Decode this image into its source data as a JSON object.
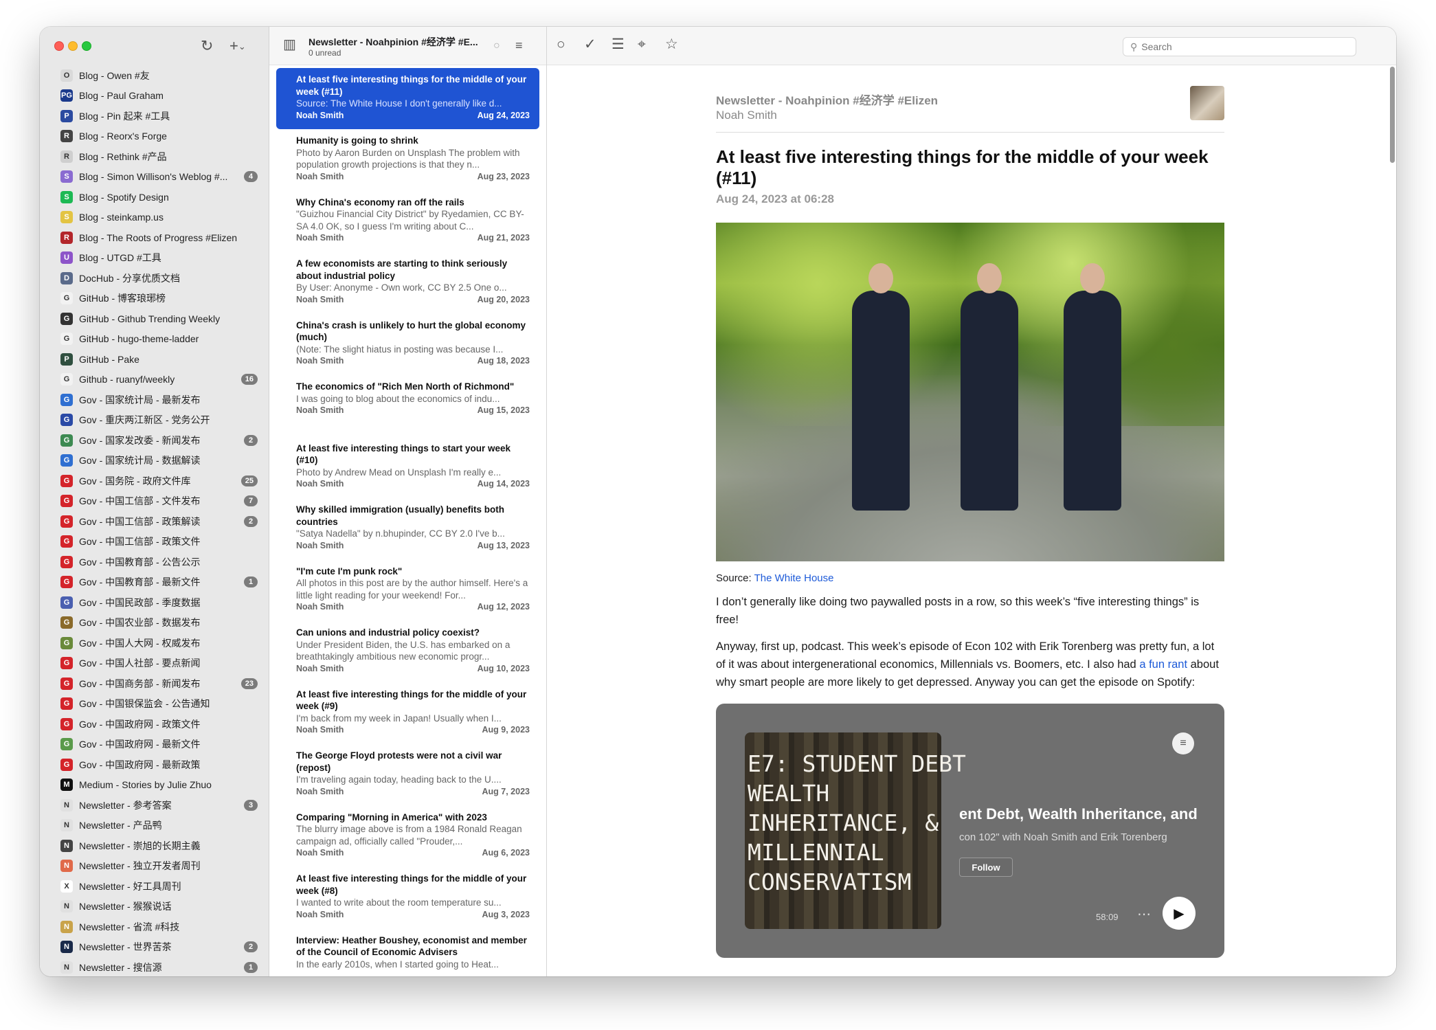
{
  "sidebar": {
    "feeds": [
      {
        "label": "Blog - Owen #友",
        "badge": "",
        "color": "#d9d9d9",
        "glyph": "O"
      },
      {
        "label": "Blog - Paul Graham",
        "badge": "",
        "color": "#1b3a8c",
        "glyph": "PG"
      },
      {
        "label": "Blog - Pin 起来 #工具",
        "badge": "",
        "color": "#2b4aa0",
        "glyph": "P"
      },
      {
        "label": "Blog - Reorx's Forge",
        "badge": "",
        "color": "#444444",
        "glyph": "R"
      },
      {
        "label": "Blog - Rethink #产品",
        "badge": "",
        "color": "#cfcfcf",
        "glyph": "R"
      },
      {
        "label": "Blog - Simon Willison's Weblog #...",
        "badge": "4",
        "color": "#8a6bd1",
        "glyph": "S"
      },
      {
        "label": "Blog - Spotify Design",
        "badge": "",
        "color": "#1db954",
        "glyph": "S"
      },
      {
        "label": "Blog - steinkamp.us",
        "badge": "",
        "color": "#e3c443",
        "glyph": "S"
      },
      {
        "label": "Blog - The Roots of Progress #Elizen",
        "badge": "",
        "color": "#b3262b",
        "glyph": "R"
      },
      {
        "label": "Blog - UTGD #工具",
        "badge": "",
        "color": "#8d54c9",
        "glyph": "U"
      },
      {
        "label": "DocHub - 分享优质文档",
        "badge": "",
        "color": "#5a6a8a",
        "glyph": "D"
      },
      {
        "label": "GitHub - 博客琅琊榜",
        "badge": "",
        "color": "#f2f2f2",
        "glyph": "G"
      },
      {
        "label": "GitHub - Github Trending Weekly",
        "badge": "",
        "color": "#333333",
        "glyph": "G"
      },
      {
        "label": "GitHub - hugo-theme-ladder",
        "badge": "",
        "color": "#f2f2f2",
        "glyph": "G"
      },
      {
        "label": "GitHub - Pake",
        "badge": "",
        "color": "#2f4f3f",
        "glyph": "P"
      },
      {
        "label": "Github - ruanyf/weekly",
        "badge": "16",
        "color": "#f2f2f2",
        "glyph": "G"
      },
      {
        "label": "Gov - 国家统计局 - 最新发布",
        "badge": "",
        "color": "#2f6fd1",
        "glyph": "G"
      },
      {
        "label": "Gov - 重庆两江新区 - 党务公开",
        "badge": "",
        "color": "#2a4aa6",
        "glyph": "G"
      },
      {
        "label": "Gov - 国家发改委 - 新闻发布",
        "badge": "2",
        "color": "#3d8a52",
        "glyph": "G"
      },
      {
        "label": "Gov - 国家统计局 - 数据解读",
        "badge": "",
        "color": "#2f6fd1",
        "glyph": "G"
      },
      {
        "label": "Gov - 国务院 - 政府文件库",
        "badge": "25",
        "color": "#d4242a",
        "glyph": "G"
      },
      {
        "label": "Gov - 中国工信部 - 文件发布",
        "badge": "7",
        "color": "#d4242a",
        "glyph": "G"
      },
      {
        "label": "Gov - 中国工信部 - 政策解读",
        "badge": "2",
        "color": "#d4242a",
        "glyph": "G"
      },
      {
        "label": "Gov - 中国工信部 - 政策文件",
        "badge": "",
        "color": "#d4242a",
        "glyph": "G"
      },
      {
        "label": "Gov - 中国教育部 - 公告公示",
        "badge": "",
        "color": "#d4242a",
        "glyph": "G"
      },
      {
        "label": "Gov - 中国教育部 - 最新文件",
        "badge": "1",
        "color": "#d4242a",
        "glyph": "G"
      },
      {
        "label": "Gov - 中国民政部 - 季度数据",
        "badge": "",
        "color": "#4a5fb0",
        "glyph": "G"
      },
      {
        "label": "Gov - 中国农业部 - 数据发布",
        "badge": "",
        "color": "#8a6a2a",
        "glyph": "G"
      },
      {
        "label": "Gov - 中国人大网 - 权威发布",
        "badge": "",
        "color": "#6a8a3a",
        "glyph": "G"
      },
      {
        "label": "Gov - 中国人社部 - 要点新闻",
        "badge": "",
        "color": "#d4242a",
        "glyph": "G"
      },
      {
        "label": "Gov - 中国商务部 - 新闻发布",
        "badge": "23",
        "color": "#d4242a",
        "glyph": "G"
      },
      {
        "label": "Gov - 中国银保监会 - 公告通知",
        "badge": "",
        "color": "#d4242a",
        "glyph": "G"
      },
      {
        "label": "Gov - 中国政府网 - 政策文件",
        "badge": "",
        "color": "#d4242a",
        "glyph": "G"
      },
      {
        "label": "Gov - 中国政府网 - 最新文件",
        "badge": "",
        "color": "#5a9a4a",
        "glyph": "G"
      },
      {
        "label": "Gov - 中国政府网 - 最新政策",
        "badge": "",
        "color": "#d4242a",
        "glyph": "G"
      },
      {
        "label": "Medium - Stories by Julie Zhuo",
        "badge": "",
        "color": "#111111",
        "glyph": "M"
      },
      {
        "label": "Newsletter - 参考答案",
        "badge": "3",
        "color": "#e0e0e0",
        "glyph": "N"
      },
      {
        "label": "Newsletter - 产品鸭",
        "badge": "",
        "color": "#e0e0e0",
        "glyph": "N"
      },
      {
        "label": "Newsletter - 崇旭的长期主義",
        "badge": "",
        "color": "#444444",
        "glyph": "N"
      },
      {
        "label": "Newsletter - 独立开发者周刊",
        "badge": "",
        "color": "#e06a4a",
        "glyph": "N"
      },
      {
        "label": "Newsletter - 好工具周刊",
        "badge": "",
        "color": "#ffffff",
        "glyph": "X"
      },
      {
        "label": "Newsletter - 猴猴说话",
        "badge": "",
        "color": "#e0e0e0",
        "glyph": "N"
      },
      {
        "label": "Newsletter - 省流 #科技",
        "badge": "",
        "color": "#c9a34a",
        "glyph": "N"
      },
      {
        "label": "Newsletter - 世界苦茶",
        "badge": "2",
        "color": "#1a2a4a",
        "glyph": "N"
      },
      {
        "label": "Newsletter - 搜信源",
        "badge": "1",
        "color": "#e0e0e0",
        "glyph": "N"
      }
    ]
  },
  "list": {
    "title": "Newsletter - Noahpinion #经济学 #E...",
    "unread": "0 unread",
    "articles": [
      {
        "title": "At least five interesting things for the middle of your week (#11)",
        "snippet": "Source: The White House I don't generally like d...",
        "author": "Noah Smith",
        "date": "Aug 24, 2023"
      },
      {
        "title": "Humanity is going to shrink",
        "snippet": "Photo by Aaron Burden on Unsplash The problem with population growth projections is that they n...",
        "author": "Noah Smith",
        "date": "Aug 23, 2023"
      },
      {
        "title": "Why China's economy ran off the rails",
        "snippet": "\"Guizhou Financial City District\" by Ryedamien, CC BY-SA 4.0 OK, so I guess I'm writing about C...",
        "author": "Noah Smith",
        "date": "Aug 21, 2023"
      },
      {
        "title": "A few economists are starting to think seriously about industrial policy",
        "snippet": "By User: Anonyme - Own work, CC BY 2.5 One o...",
        "author": "Noah Smith",
        "date": "Aug 20, 2023"
      },
      {
        "title": "China's crash is unlikely to hurt the global economy (much)",
        "snippet": "(Note: The slight hiatus in posting was because I...",
        "author": "Noah Smith",
        "date": "Aug 18, 2023"
      },
      {
        "title": "The economics of \"Rich Men North of Richmond\"",
        "snippet": "I was going to blog about the economics of indu...",
        "author": "Noah Smith",
        "date": "Aug 15, 2023"
      },
      {
        "title": "At least five interesting things to start your week (#10)",
        "snippet": "Photo by Andrew Mead on Unsplash I'm really e...",
        "author": "Noah Smith",
        "date": "Aug 14, 2023"
      },
      {
        "title": "Why skilled immigration (usually) benefits both countries",
        "snippet": "\"Satya Nadella\" by n.bhupinder, CC BY 2.0 I've b...",
        "author": "Noah Smith",
        "date": "Aug 13, 2023"
      },
      {
        "title": "\"I'm cute I'm punk rock\"",
        "snippet": "All photos in this post are by the author himself. Here's a little light reading for your weekend! For...",
        "author": "Noah Smith",
        "date": "Aug 12, 2023"
      },
      {
        "title": "Can unions and industrial policy coexist?",
        "snippet": "Under President Biden, the U.S. has embarked on a breathtakingly ambitious new economic progr...",
        "author": "Noah Smith",
        "date": "Aug 10, 2023"
      },
      {
        "title": "At least five interesting things for the middle of your week (#9)",
        "snippet": "I'm back from my week in Japan! Usually when I...",
        "author": "Noah Smith",
        "date": "Aug 9, 2023"
      },
      {
        "title": "The George Floyd protests were not a civil war (repost)",
        "snippet": "I'm traveling again today, heading back to the U....",
        "author": "Noah Smith",
        "date": "Aug 7, 2023"
      },
      {
        "title": "Comparing \"Morning in America\" with 2023",
        "snippet": "The blurry image above is from a 1984 Ronald Reagan campaign ad, officially called \"Prouder,...",
        "author": "Noah Smith",
        "date": "Aug 6, 2023"
      },
      {
        "title": "At least five interesting things for the middle of your week (#8)",
        "snippet": "I wanted to write about the room temperature su...",
        "author": "Noah Smith",
        "date": "Aug 3, 2023"
      },
      {
        "title": "Interview: Heather Boushey, economist and member of the Council of Economic Advisers",
        "snippet": "In the early 2010s, when I started going to Heat...",
        "author": "",
        "date": ""
      }
    ]
  },
  "reader": {
    "search_placeholder": "Search",
    "feed_name": "Newsletter - Noahpinion #经济学 #Elizen",
    "author": "Noah Smith",
    "title": "At least five interesting things for the middle of your week (#11)",
    "date": "Aug 24, 2023 at 06:28",
    "source_prefix": "Source: ",
    "source_link": "The White House",
    "para1": "I don’t generally like doing two paywalled posts in a row, so this week’s “five interesting things” is free!",
    "para2_a": "Anyway, first up, podcast. This week’s episode of Econ 102 with Erik Torenberg was pretty fun, a lot of it was about intergenerational economics, Millennials vs. Boomers, etc. I also had ",
    "para2_link": "a fun rant",
    "para2_b": " about why smart people are more likely to get depressed. Anyway you can get the episode on Spotify:",
    "embed": {
      "cover_lines": [
        "E7: STUDENT DEBT",
        "WEALTH",
        "INHERITANCE, &",
        "MILLENNIAL",
        "CONSERVATISM"
      ],
      "title": "ent Debt, Wealth Inheritance, and",
      "subtitle": "con 102\" with Noah Smith and Erik Torenberg",
      "follow": "Follow",
      "duration": "58:09"
    }
  },
  "icons": [
    "refresh-icon",
    "add-icon",
    "sidebar-toggle-icon",
    "circle-icon",
    "check-icon",
    "document-icon",
    "compass-icon",
    "star-icon",
    "search-icon",
    "share-icon",
    "filter-icon"
  ]
}
